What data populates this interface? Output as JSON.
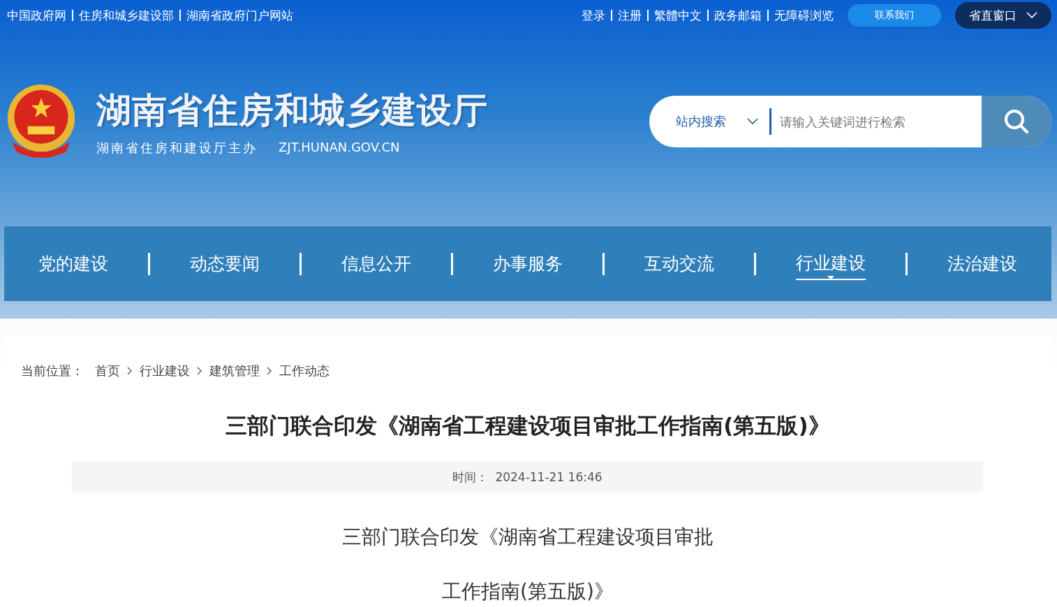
{
  "top_links": [
    "中国政府网",
    "住房和城乡建设部",
    "湖南省政府门户网站"
  ],
  "top_right_links": [
    "登录",
    "注册",
    "繁體中文",
    "政务邮箱",
    "无障碍浏览"
  ],
  "contact_button": "联系我们",
  "province_window": "省直窗口",
  "site_title": "湖南省住房和城乡建设厅",
  "site_subtitle": "湖南省住房和建设厅主办",
  "site_domain": "ZJT.HUNAN.GOV.CN",
  "search": {
    "scope": "站内搜索",
    "placeholder": "请输入关键词进行检索"
  },
  "nav": [
    {
      "label": "党的建设",
      "selected": false
    },
    {
      "label": "动态要闻",
      "selected": false
    },
    {
      "label": "信息公开",
      "selected": false
    },
    {
      "label": "办事服务",
      "selected": false
    },
    {
      "label": "互动交流",
      "selected": false
    },
    {
      "label": "行业建设",
      "selected": true
    },
    {
      "label": "法治建设",
      "selected": false
    }
  ],
  "breadcrumb": {
    "prefix": "当前位置：",
    "items": [
      "首页",
      "行业建设",
      "建筑管理",
      "工作动态"
    ]
  },
  "article": {
    "title": "三部门联合印发《湖南省工程建设项目审批工作指南(第五版)》",
    "meta_label": "时间：",
    "meta_time": "2024-11-21 16:46",
    "body_lines": [
      "三部门联合印发《湖南省工程建设项目审批",
      "工作指南(第五版)》"
    ]
  }
}
